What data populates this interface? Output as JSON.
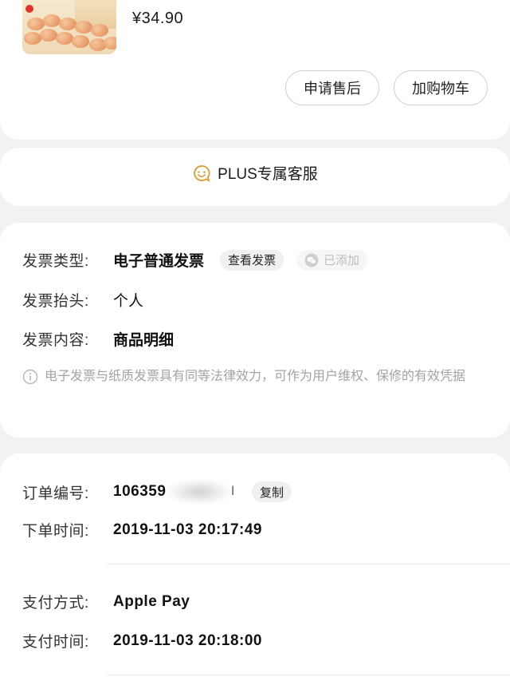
{
  "product": {
    "price": "¥34.90",
    "after_sale_label": "申请售后",
    "add_cart_label": "加购物车"
  },
  "service": {
    "plus_label": "PLUS专属客服",
    "icon": "smile-chat-icon",
    "icon_color": "#d9a441"
  },
  "invoice": {
    "type_label": "发票类型:",
    "type_value": "电子普通发票",
    "view_label": "查看发票",
    "added_label": "已添加",
    "title_label": "发票抬头:",
    "title_value": "个人",
    "content_label": "发票内容:",
    "content_value": "商品明细",
    "note": "电子发票与纸质发票具有同等法律效力，可作为用户维权、保修的有效凭据"
  },
  "order": {
    "number_label": "订单编号:",
    "number_value": "106359",
    "number_tail": "l",
    "copy_label": "复制",
    "time_label": "下单时间:",
    "time_value": "2019-11-03 20:17:49",
    "pay_method_label": "支付方式:",
    "pay_method_value": "Apple Pay",
    "pay_time_label": "支付时间:",
    "pay_time_value": "2019-11-03 20:18:00"
  }
}
